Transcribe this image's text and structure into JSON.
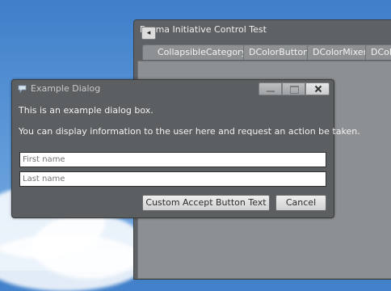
{
  "background_frame": {
    "title": "Derma Initiative Control Test",
    "tabs": [
      {
        "label": "CollapsibleCategory"
      },
      {
        "label": "DColorButton"
      },
      {
        "label": "DColorMixer"
      },
      {
        "label": "DColo"
      }
    ],
    "nav_icon": "chevron-left-icon"
  },
  "dialog": {
    "title": "Example Dialog",
    "title_icon": "speech-bubble-icon",
    "window_buttons": [
      "minimize-icon",
      "maximize-icon",
      "close-icon"
    ],
    "line1": "This is an example dialog box.",
    "line2": "You can display information to the user here and request an action be taken.",
    "first_name_placeholder": "First name",
    "last_name_placeholder": "Last name",
    "accept_label": "Custom Accept Button Text",
    "cancel_label": "Cancel"
  },
  "colors": {
    "frame_bg": "#5f6264",
    "dialog_bg": "#5c5f61",
    "sky_top": "#3f7fc9"
  }
}
